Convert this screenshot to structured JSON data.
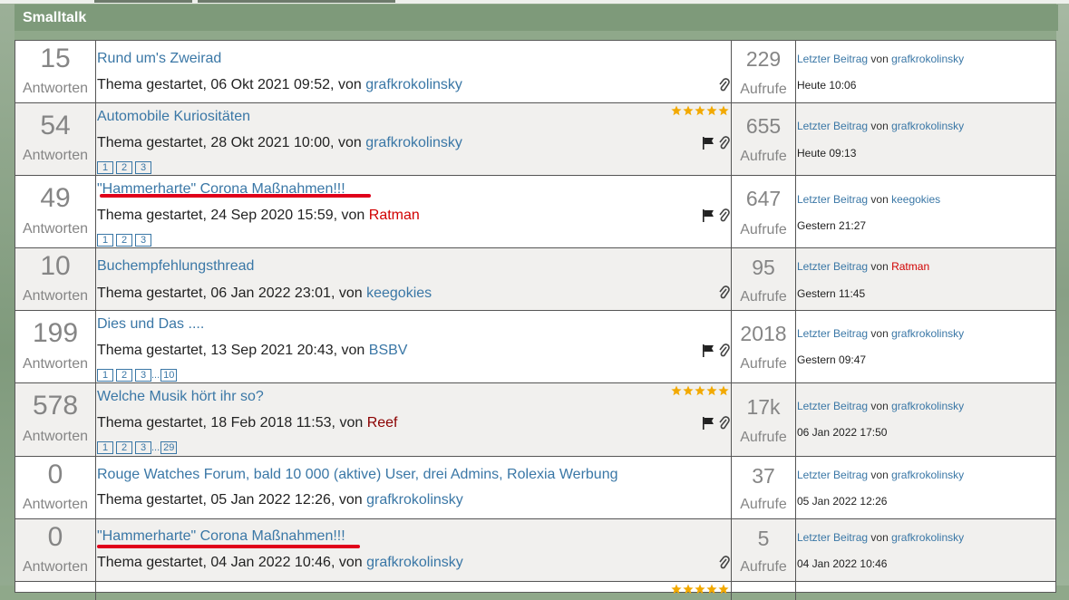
{
  "section": {
    "title": "Smalltalk"
  },
  "labels": {
    "answers": "Antworten",
    "views": "Aufrufe",
    "last_post": "Letzter Beitrag",
    "von": "von",
    "started_prefix": "Thema gestartet, ",
    "by": ", von "
  },
  "threads": [
    {
      "answers": "15",
      "title": "Rund um's Zweirad",
      "started": "06 Okt 2021 09:52",
      "author": "grafkrokolinsky",
      "views": "229",
      "last_by": "grafkrokolinsky",
      "last_time": "Heute 10:06"
    },
    {
      "answers": "54",
      "title": "Automobile Kuriositäten",
      "started": "28 Okt 2021 10:00",
      "author": "grafkrokolinsky",
      "pages": [
        "1",
        "2",
        "3"
      ],
      "views": "655",
      "last_by": "grafkrokolinsky",
      "last_time": "Heute 09:13"
    },
    {
      "answers": "49",
      "title": "\"Hammerharte\" Corona Maßnahmen!!!",
      "started": "24 Sep 2020 15:59",
      "author": "Ratman",
      "pages": [
        "1",
        "2",
        "3"
      ],
      "views": "647",
      "last_by": "keegokies",
      "last_time": "Gestern 21:27"
    },
    {
      "answers": "10",
      "title": "Buchempfehlungsthread",
      "started": "06 Jan 2022 23:01",
      "author": "keegokies",
      "views": "95",
      "last_by": "Ratman",
      "last_time": "Gestern 11:45"
    },
    {
      "answers": "199",
      "title": "Dies und Das ....",
      "started": "13 Sep 2021 20:43",
      "author": "BSBV",
      "pages": [
        "1",
        "2",
        "3",
        "...",
        "10"
      ],
      "views": "2018",
      "last_by": "grafkrokolinsky",
      "last_time": "Gestern 09:47"
    },
    {
      "answers": "578",
      "title": "Welche Musik hört ihr so?",
      "started": "18 Feb 2018 11:53",
      "author": "Reef",
      "pages": [
        "1",
        "2",
        "3",
        "...",
        "29"
      ],
      "views": "17k",
      "last_by": "grafkrokolinsky",
      "last_time": "06 Jan 2022 17:50"
    },
    {
      "answers": "0",
      "title": "Rouge Watches Forum, bald 10 000 (aktive) User, drei Admins, Rolexia Werbung",
      "started": "05 Jan 2022 12:26",
      "author": "grafkrokolinsky",
      "views": "37",
      "last_by": "grafkrokolinsky",
      "last_time": "05 Jan 2022 12:26"
    },
    {
      "answers": "0",
      "title": "\"Hammerharte\" Corona Maßnahmen!!!",
      "started": "04 Jan 2022 10:46",
      "author": "grafkrokolinsky",
      "views": "5",
      "last_by": "grafkrokolinsky",
      "last_time": "04 Jan 2022 10:46"
    }
  ],
  "icons": {
    "attachment": "paperclip-icon",
    "flag": "flag-icon",
    "rating": "star-icon"
  },
  "colors": {
    "header": "#7e9a7a",
    "link": "#3a77a6",
    "user_red": "#d10000",
    "user_dark_red": "#8b0000",
    "underline": "#e0001a",
    "star": "#f2a900"
  }
}
